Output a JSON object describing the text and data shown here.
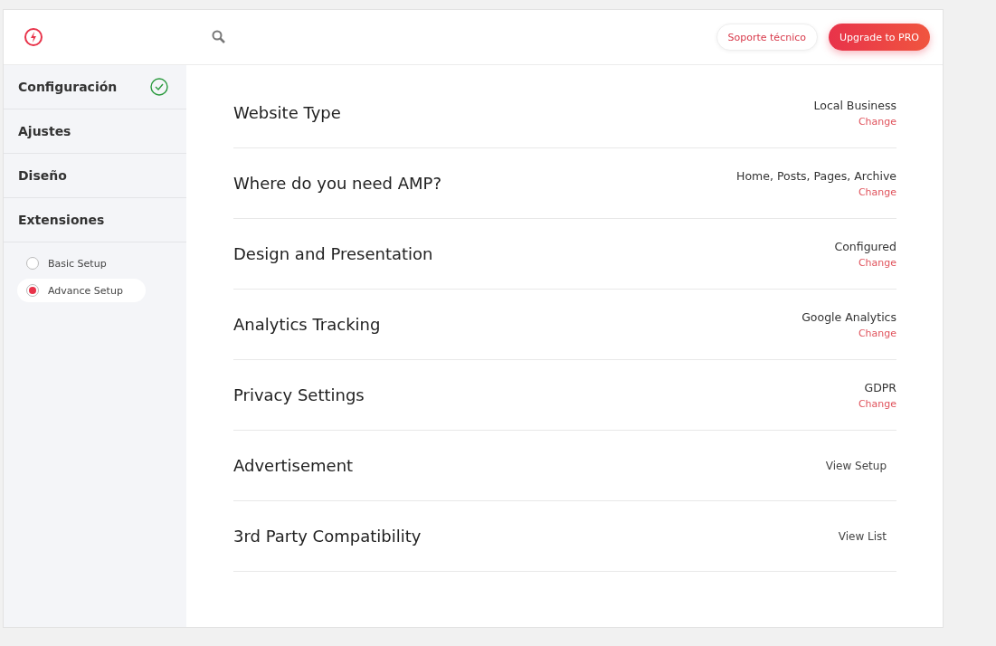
{
  "header": {
    "support_button": "Soporte técnico",
    "upgrade_button": "Upgrade to PRO"
  },
  "sidebar": {
    "items": [
      {
        "label": "Configuración",
        "done": true
      },
      {
        "label": "Ajustes",
        "done": false
      },
      {
        "label": "Diseño",
        "done": false
      },
      {
        "label": "Extensiones",
        "done": false
      }
    ],
    "sub_items": [
      {
        "label": "Basic Setup",
        "selected": false
      },
      {
        "label": "Advance Setup",
        "selected": true
      }
    ]
  },
  "rows": [
    {
      "kind": "value",
      "title": "Website Type",
      "value": "Local Business",
      "link": "Change"
    },
    {
      "kind": "value",
      "title": "Where do you need AMP?",
      "value": "Home, Posts, Pages, Archive",
      "link": "Change"
    },
    {
      "kind": "value",
      "title": "Design and Presentation",
      "value": "Configured",
      "link": "Change"
    },
    {
      "kind": "value",
      "title": "Analytics Tracking",
      "value": "Google Analytics",
      "link": "Change"
    },
    {
      "kind": "value",
      "title": "Privacy Settings",
      "value": "GDPR",
      "link": "Change"
    },
    {
      "kind": "action",
      "title": "Advertisement",
      "link": "View Setup"
    },
    {
      "kind": "action",
      "title": "3rd Party Compatibility",
      "link": "View List"
    }
  ]
}
